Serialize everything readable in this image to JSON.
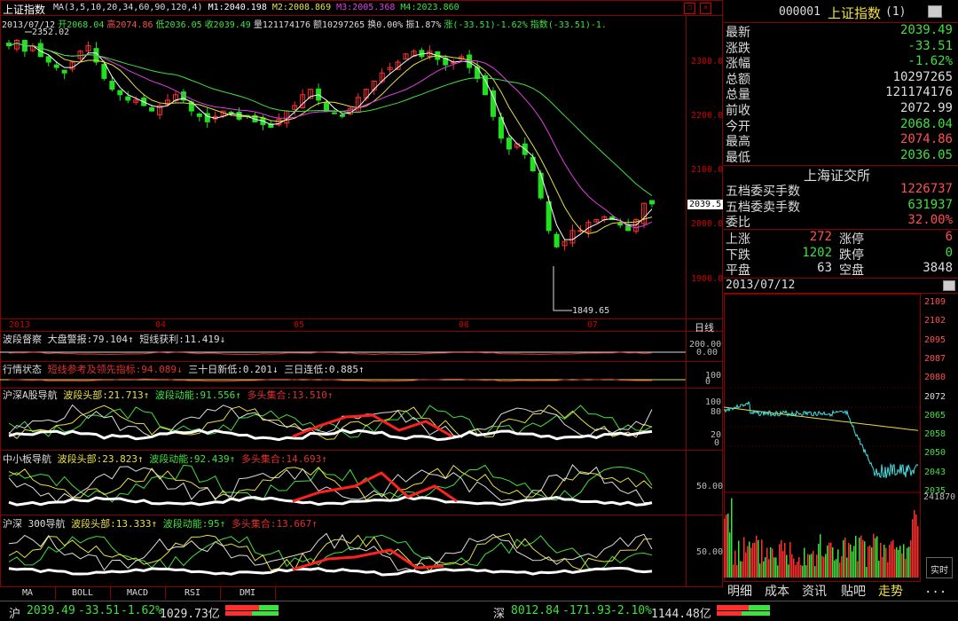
{
  "title": "上证指数",
  "window_controls": {
    "restore": "❐",
    "close": "✕"
  },
  "infoline": {
    "ma": "MA(3,5,10,20,34,60,90,120,4)",
    "m1": "M1:2040.198",
    "m2": "M2:2008.869",
    "m3": "M3:2005.368",
    "m4": "M4:2023.860",
    "date": "2013/07/12",
    "open": "开2068.04",
    "high": "高2074.86",
    "low": "低2036.05",
    "close": "收2039.49",
    "volume": "量121174176",
    "amount": "额10297265",
    "turnover": "换0.00%",
    "amplitude": "振1.87%",
    "change": "涨(-33.51)-1.62%",
    "index": "指数(-33.51)-1."
  },
  "annotations": {
    "high_label": "2352.02",
    "low_label": "1849.65",
    "price_tag": "2039.5"
  },
  "price_axis": [
    "2300.0",
    "2200.0",
    "2100.0",
    "2000.0",
    "1900.0"
  ],
  "date_axis": [
    "2013",
    "04",
    "05",
    "06",
    "07"
  ],
  "period": "日线",
  "panels": [
    {
      "name": "波段督察",
      "items": [
        {
          "t": "大盘警报:79.104↑",
          "c": "#ddd"
        },
        {
          "t": "短线获利:11.419↓",
          "c": "#ddd"
        }
      ],
      "axis": [
        "200.00",
        "0.00"
      ]
    },
    {
      "name": "行情状态",
      "items": [
        {
          "t": "短线参考及领先指标:94.089↓",
          "c": "#e03030"
        },
        {
          "t": "三十日新低:0.201↓",
          "c": "#ddd"
        },
        {
          "t": "三日连低:0.885↑",
          "c": "#ddd"
        }
      ],
      "axis": [
        "100",
        "0"
      ]
    },
    {
      "name": "沪深A股导航",
      "items": [
        {
          "t": "波段头部:21.713↑",
          "c": "#e8e040"
        },
        {
          "t": "波段动能:91.556↑",
          "c": "#40e040"
        },
        {
          "t": "多头集合:13.510↑",
          "c": "#e03030"
        }
      ],
      "axis": [
        "100",
        "80",
        "20",
        "0"
      ]
    },
    {
      "name": "中小板导航",
      "items": [
        {
          "t": "波段头部:23.823↑",
          "c": "#e8e040"
        },
        {
          "t": "波段动能:92.439↑",
          "c": "#40e040"
        },
        {
          "t": "多头集合:14.693↑",
          "c": "#e03030"
        }
      ],
      "axis": [
        "50.00"
      ]
    },
    {
      "name": "沪深 300导航",
      "items": [
        {
          "t": "波段头部:13.333↑",
          "c": "#e8e040"
        },
        {
          "t": "波段动能:95↑",
          "c": "#40e040"
        },
        {
          "t": "多头集合:13.667↑",
          "c": "#e03030"
        }
      ],
      "axis": [
        "50.00"
      ]
    }
  ],
  "indicator_tabs": [
    "MA",
    "BOLL",
    "MACD",
    "RSI",
    "DMI"
  ],
  "quote": {
    "code": "000001",
    "name": "上证指数",
    "suffix": "(1)",
    "rows": [
      {
        "k": "最新",
        "v": "2039.49",
        "c": "#40e040"
      },
      {
        "k": "涨跌",
        "v": "-33.51",
        "c": "#40e040"
      },
      {
        "k": "涨幅",
        "v": "-1.62%",
        "c": "#40e040"
      },
      {
        "k": "总额",
        "v": "10297265",
        "c": "#ddd"
      },
      {
        "k": "总量",
        "v": "121174176",
        "c": "#ddd"
      },
      {
        "k": "前收",
        "v": "2072.99",
        "c": "#ddd"
      },
      {
        "k": "今开",
        "v": "2068.04",
        "c": "#40e040"
      },
      {
        "k": "最高",
        "v": "2074.86",
        "c": "#ff5050"
      },
      {
        "k": "最低",
        "v": "2036.05",
        "c": "#40e040"
      }
    ],
    "exchange": "上海证交所",
    "orders": [
      {
        "k": "五档委买手数",
        "v": "1226737",
        "c": "#ff5050"
      },
      {
        "k": "五档委卖手数",
        "v": "631937",
        "c": "#40e040"
      },
      {
        "k": "委比",
        "v": "32.00%",
        "c": "#ff5050"
      }
    ],
    "breadth": [
      {
        "k1": "上涨",
        "v1": "272",
        "c1": "#ff5050",
        "k2": "涨停",
        "v2": "6",
        "c2": "#ff5050"
      },
      {
        "k1": "下跌",
        "v1": "1202",
        "c1": "#40e040",
        "k2": "跌停",
        "v2": "0",
        "c2": "#40e040"
      },
      {
        "k1": "平盘",
        "v1": "63",
        "c1": "#ddd",
        "k2": "空盘",
        "v2": "3848",
        "c2": "#ddd"
      }
    ],
    "mini_date": "2013/07/12",
    "mini_axis": [
      "2109",
      "2102",
      "2095",
      "2087",
      "2080",
      "2072",
      "2065",
      "2058",
      "2050",
      "2043",
      "2035"
    ],
    "mini_volume": "241870",
    "realtime_label": "实时",
    "bottom_tabs": [
      "明细",
      "成本",
      "资讯",
      "贴吧",
      "走势",
      "..."
    ]
  },
  "statusbar": {
    "sh_label": "沪",
    "sh_value": "2039.49",
    "sh_change": "-33.51",
    "sh_pct": "-1.62%",
    "sh_amount": "1029.73亿",
    "sz_label": "深",
    "sz_value": "8012.84",
    "sz_change": "-171.93",
    "sz_pct": "-2.10%",
    "sz_amount": "1144.48亿"
  },
  "colors": {
    "up": "#ff3030",
    "down": "#20e0e0",
    "green": "#40e040",
    "yellow": "#e8e040",
    "magenta": "#e040e0",
    "border": "#880000"
  }
}
